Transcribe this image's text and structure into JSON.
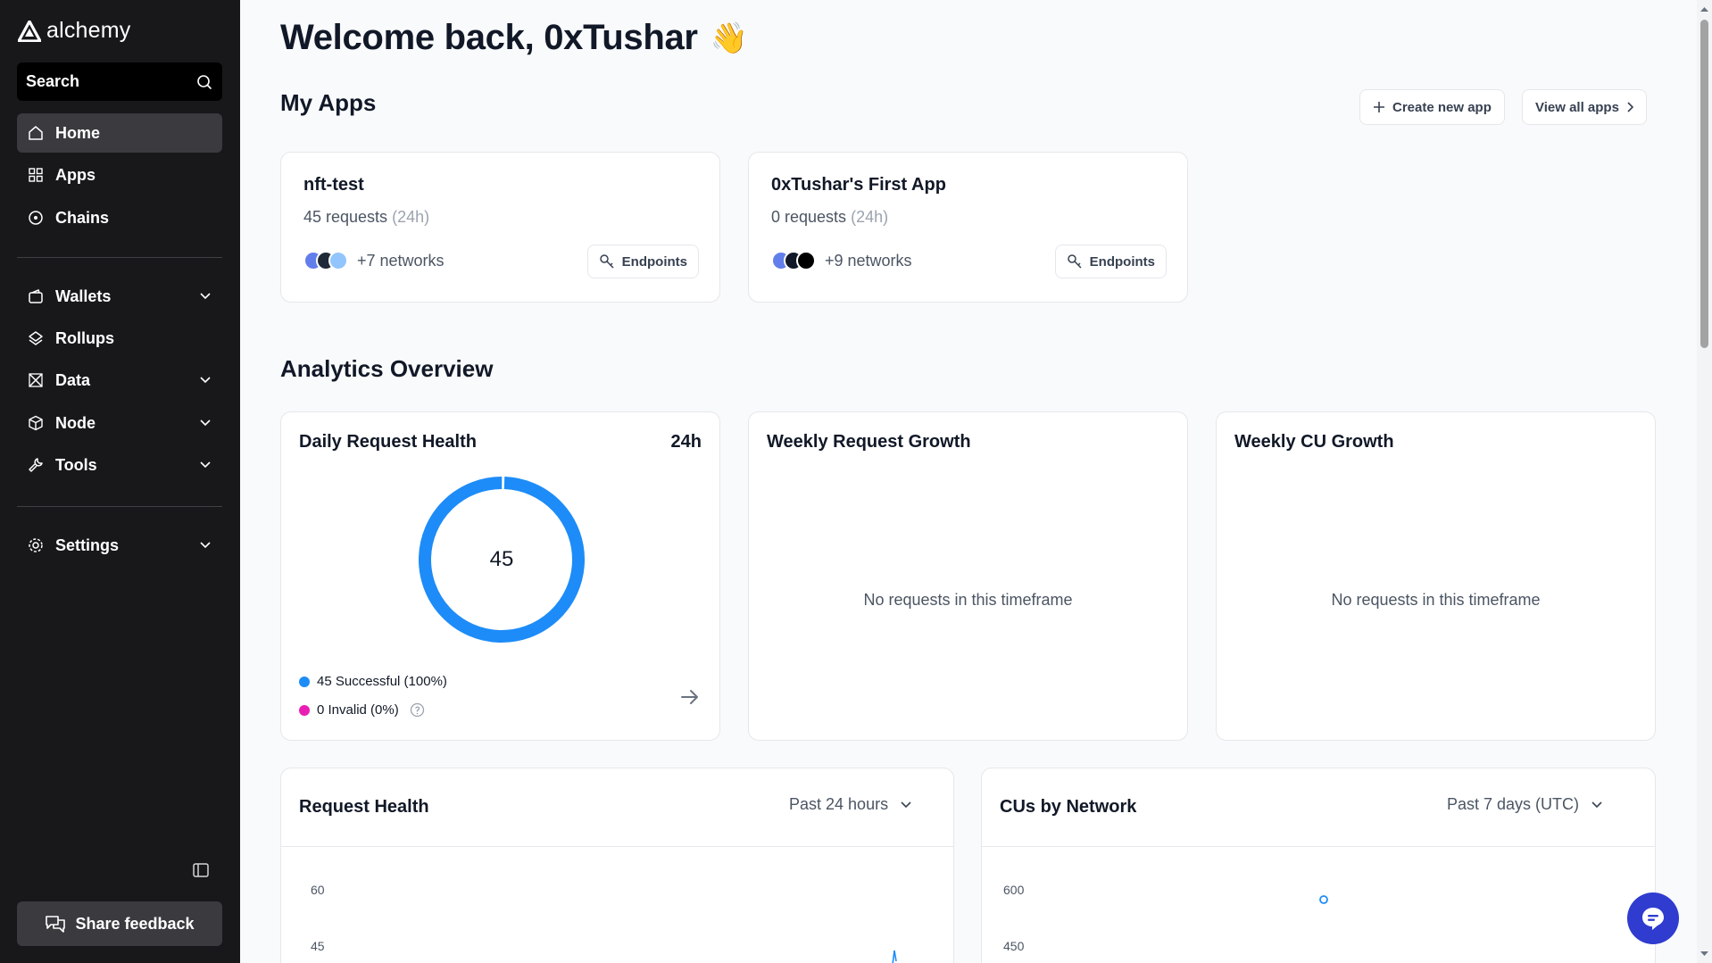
{
  "sidebar": {
    "brand": "alchemy",
    "search_label": "Search",
    "nav_main": [
      {
        "label": "Home",
        "icon": "home-icon"
      },
      {
        "label": "Apps",
        "icon": "grid-icon"
      },
      {
        "label": "Chains",
        "icon": "chains-icon"
      }
    ],
    "nav_products": [
      {
        "label": "Wallets",
        "icon": "wallet-icon"
      },
      {
        "label": "Rollups",
        "icon": "layers-icon"
      },
      {
        "label": "Data",
        "icon": "data-icon"
      },
      {
        "label": "Node",
        "icon": "cube-icon"
      },
      {
        "label": "Tools",
        "icon": "wrench-icon"
      }
    ],
    "settings_label": "Settings",
    "feedback_label": "Share feedback"
  },
  "header": {
    "welcome": "Welcome back, 0xTushar",
    "wave_emoji": "👋"
  },
  "my_apps": {
    "title": "My Apps",
    "create_label": "Create new app",
    "view_all_label": "View all apps",
    "apps": [
      {
        "name": "nft-test",
        "requests": "45 requests",
        "period": "(24h)",
        "networks": "+7 networks",
        "endpoints_label": "Endpoints"
      },
      {
        "name": "0xTushar's First App",
        "requests": "0 requests",
        "period": "(24h)",
        "networks": "+9 networks",
        "endpoints_label": "Endpoints"
      }
    ]
  },
  "analytics": {
    "title": "Analytics Overview",
    "daily": {
      "title": "Daily Request Health",
      "range": "24h",
      "total": "45",
      "successful_label": "45 Successful (100%)",
      "invalid_label": "0 Invalid (0%)",
      "success_fraction": 1.0,
      "colors": {
        "successful": "#1d8cf8",
        "invalid": "#e91eb4"
      }
    },
    "weekly_request": {
      "title": "Weekly Request Growth",
      "empty": "No requests in this timeframe"
    },
    "weekly_cu": {
      "title": "Weekly CU Growth",
      "empty": "No requests in this timeframe"
    }
  },
  "request_health": {
    "title": "Request Health",
    "range": "Past 24 hours",
    "y_ticks": [
      "60",
      "45"
    ]
  },
  "cus_by_network": {
    "title": "CUs by Network",
    "range": "Past 7 days (UTC)",
    "y_ticks": [
      "600",
      "450"
    ]
  },
  "colors": {
    "sidebar_bg": "#18181b",
    "accent_blue": "#1d8cf8",
    "chat_button": "#2f3ccf"
  }
}
